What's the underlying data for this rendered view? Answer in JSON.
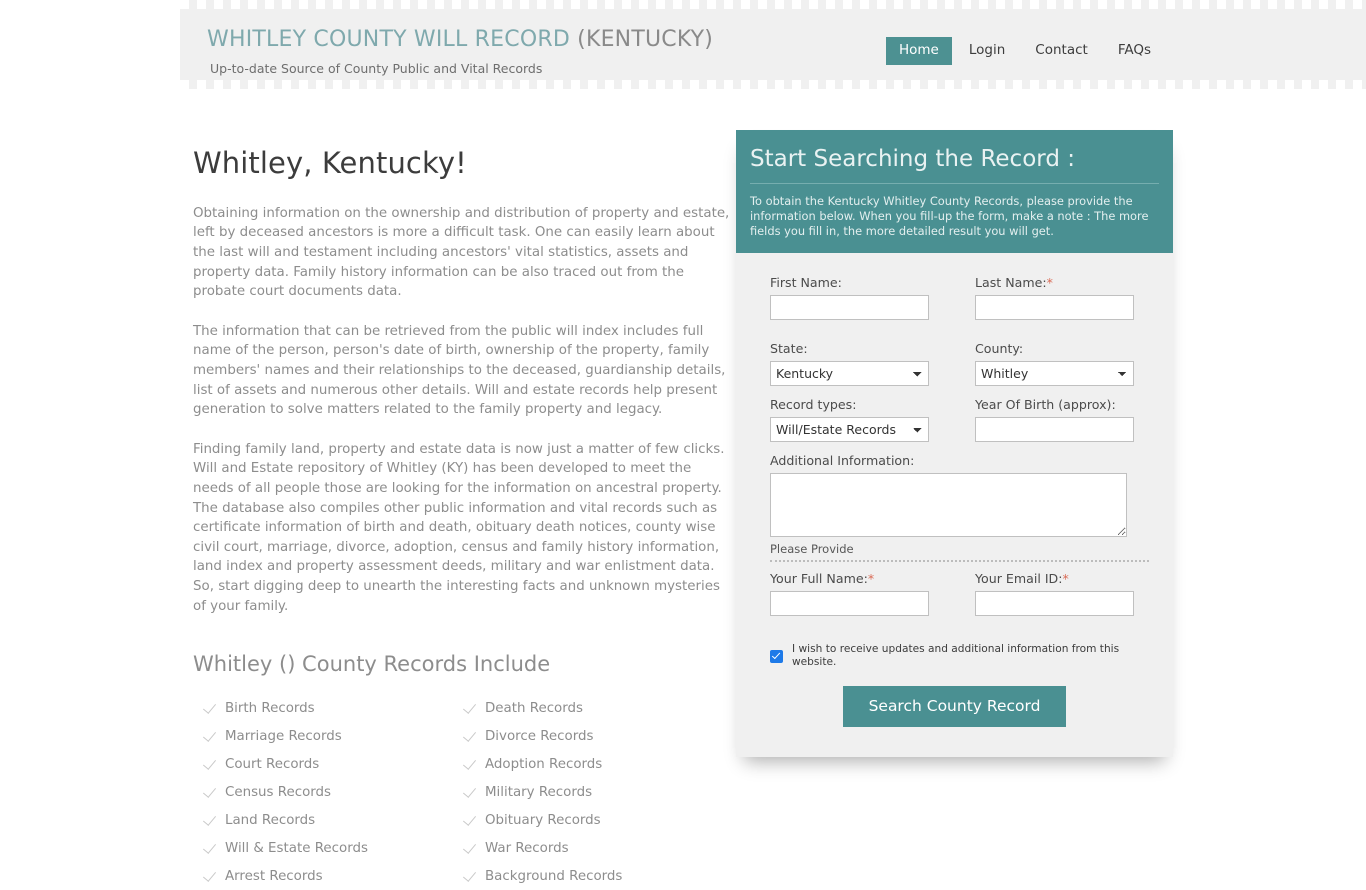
{
  "header": {
    "brand_main": "WHITLEY COUNTY WILL RECORD ",
    "brand_sub": "(KENTUCKY)",
    "tagline": "Up-to-date Source of  County Public and Vital Records",
    "nav": [
      {
        "label": "Home",
        "active": true
      },
      {
        "label": "Login",
        "active": false
      },
      {
        "label": "Contact",
        "active": false
      },
      {
        "label": "FAQs",
        "active": false
      }
    ]
  },
  "content": {
    "page_title": "Whitley, Kentucky!",
    "paragraphs": [
      "Obtaining information on the ownership and distribution of property and estate, left by deceased ancestors is more a difficult task. One can easily learn about the last will and testament including ancestors' vital statistics, assets and property data. Family history information can be also traced out from the probate court documents data.",
      "The information that can be retrieved from the public will index includes full name of the person, person's date of birth, ownership of the property, family members' names and their relationships to the deceased, guardianship details, list of assets and numerous other details. Will and estate records help present generation to solve matters related to the family property and legacy.",
      "Finding family land, property and estate data is now just a matter of few clicks. Will and Estate repository of Whitley (KY) has been developed to meet the needs of all people those are looking for the information on ancestral property. The database also compiles other public information and vital records such as certificate information of birth and death, obituary death notices, county wise civil court, marriage, divorce, adoption, census and family history information, land index and property assessment deeds, military and war enlistment data. So, start digging deep to unearth the interesting facts and unknown mysteries of your family."
    ],
    "records_title": "Whitley () County Records Include",
    "records": [
      "Birth Records",
      "Death Records",
      "Marriage Records",
      "Divorce Records",
      "Court Records",
      "Adoption Records",
      "Census Records",
      "Military Records",
      "Land Records",
      "Obituary Records",
      "Will & Estate Records",
      "War Records",
      "Arrest Records",
      "Background Records"
    ]
  },
  "form": {
    "heading": "Start Searching the Record :",
    "intro": "To obtain the Kentucky Whitley County Records, please provide the information below. When you fill-up the form, make a note : The more fields you fill in, the more detailed result you will get.",
    "first_name_label": "First Name:",
    "first_name_value": "",
    "last_name_label": "Last Name:",
    "last_name_required": "*",
    "last_name_value": "",
    "state_label": "State:",
    "state_value": "Kentucky",
    "state_options": [
      "Kentucky"
    ],
    "county_label": "County:",
    "county_value": "Whitley",
    "county_options": [
      "Whitley"
    ],
    "record_types_label": "Record types:",
    "record_types_value": "Will/Estate Records",
    "record_types_options": [
      "Will/Estate Records"
    ],
    "year_label": "Year Of Birth (approx):",
    "year_value": "",
    "additional_label": "Additional Information:",
    "additional_value": "",
    "provide_label": "Please Provide",
    "full_name_label": "Your Full Name:",
    "full_name_required": "*",
    "full_name_value": "",
    "email_label": "Your Email ID:",
    "email_required": "*",
    "email_value": "",
    "consent_text": "I wish to receive updates and additional information from this website.",
    "consent_checked": true,
    "submit_label": "Search County Record"
  },
  "colors": {
    "teal": "#4a9092",
    "brand_teal": "#7fa9ad",
    "panel_gray": "#f0f0f0",
    "body_text": "#8d8d8d",
    "required_red": "#d96a55",
    "checkbox_blue": "#1e7ae8"
  }
}
